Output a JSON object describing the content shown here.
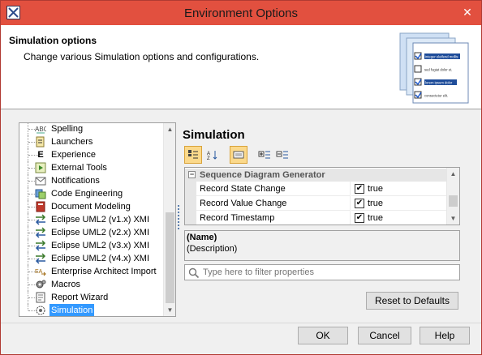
{
  "window": {
    "title": "Environment Options"
  },
  "header": {
    "title": "Simulation options",
    "subtitle": "Change various Simulation options and configurations.",
    "art_lines": [
      "integer eleifend mollis",
      "sed fugiat dolor et.",
      "lorem ipsum dolor",
      "consectetur elit."
    ]
  },
  "tree": {
    "items": [
      {
        "label": "Spelling",
        "icon": "spelling-icon"
      },
      {
        "label": "Launchers",
        "icon": "launcher-icon"
      },
      {
        "label": "Experience",
        "icon": "experience-icon"
      },
      {
        "label": "External Tools",
        "icon": "external-tools-icon"
      },
      {
        "label": "Notifications",
        "icon": "envelope-icon"
      },
      {
        "label": "Code Engineering",
        "icon": "code-engineering-icon"
      },
      {
        "label": "Document Modeling",
        "icon": "document-icon"
      },
      {
        "label": "Eclipse UML2 (v1.x) XMI",
        "icon": "exchange-arrows-icon"
      },
      {
        "label": "Eclipse UML2 (v2.x) XMI",
        "icon": "exchange-arrows-icon"
      },
      {
        "label": "Eclipse UML2 (v3.x) XMI",
        "icon": "exchange-arrows-icon"
      },
      {
        "label": "Eclipse UML2 (v4.x) XMI",
        "icon": "exchange-arrows-icon"
      },
      {
        "label": "Enterprise Architect Import",
        "icon": "ea-import-icon"
      },
      {
        "label": "Macros",
        "icon": "macros-gear-icon"
      },
      {
        "label": "Report Wizard",
        "icon": "report-icon"
      },
      {
        "label": "Simulation",
        "icon": "simulation-gear-icon"
      }
    ],
    "selected": "Simulation"
  },
  "panel": {
    "title": "Simulation",
    "category": "Sequence Diagram Generator",
    "properties": [
      {
        "name": "Record State Change",
        "value": "true",
        "checked": true
      },
      {
        "name": "Record Value Change",
        "value": "true",
        "checked": true
      },
      {
        "name": "Record Timestamp",
        "value": "true",
        "checked": true
      }
    ],
    "description_name": "(Name)",
    "description_text": "(Description)",
    "filter_placeholder": "Type here to filter properties",
    "reset_label": "Reset to Defaults"
  },
  "footer": {
    "ok_label": "OK",
    "cancel_label": "Cancel",
    "help_label": "Help"
  },
  "colors": {
    "title_bar": "#e2503f",
    "selection": "#3399ff",
    "active_toggle": "#fbd98b"
  }
}
